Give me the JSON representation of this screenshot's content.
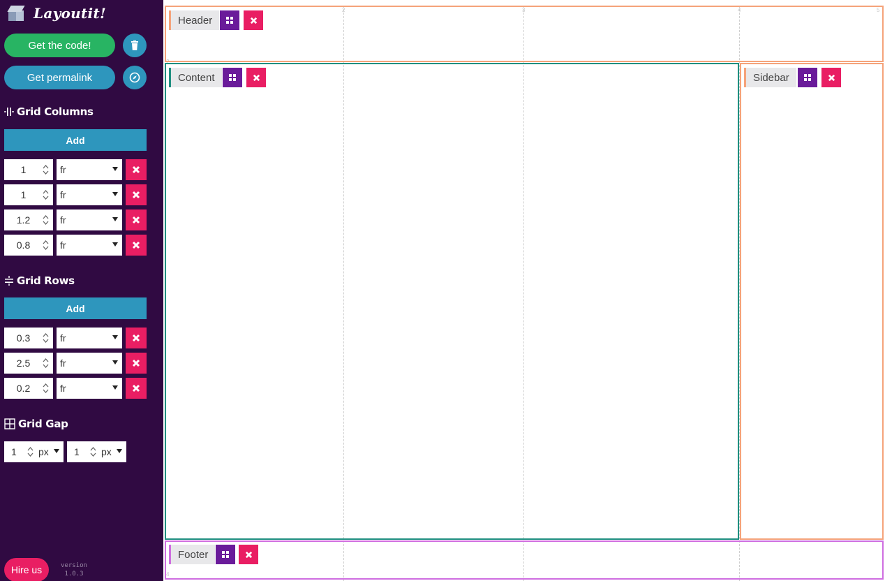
{
  "app": {
    "title": "Layoutit!"
  },
  "actions": {
    "get_code": "Get the code!",
    "get_permalink": "Get permalink"
  },
  "columns": {
    "title": "Grid Columns",
    "add_label": "Add",
    "items": [
      {
        "value": "1",
        "unit": "fr"
      },
      {
        "value": "1",
        "unit": "fr"
      },
      {
        "value": "1.2",
        "unit": "fr"
      },
      {
        "value": "0.8",
        "unit": "fr"
      }
    ]
  },
  "rows": {
    "title": "Grid Rows",
    "add_label": "Add",
    "items": [
      {
        "value": "0.3",
        "unit": "fr"
      },
      {
        "value": "2.5",
        "unit": "fr"
      },
      {
        "value": "0.2",
        "unit": "fr"
      }
    ]
  },
  "gap": {
    "title": "Grid Gap",
    "column": {
      "value": "1",
      "unit": "px"
    },
    "row": {
      "value": "1",
      "unit": "px"
    }
  },
  "footer": {
    "hire_label": "Hire us",
    "version_label": "version",
    "version_number": "1.0.3"
  },
  "grid": {
    "column_line_numbers": [
      "2",
      "3",
      "4",
      "5"
    ],
    "row_line_numbers": [
      "2",
      "4"
    ],
    "areas": {
      "header": {
        "label": "Header",
        "color": "#f5a37a"
      },
      "content": {
        "label": "Content",
        "color": "#1f8f80"
      },
      "sidebar": {
        "label": "Sidebar",
        "color": "#f5a37a"
      },
      "footer": {
        "label": "Footer",
        "color": "#cf6ee0"
      }
    }
  },
  "colors": {
    "sidebar_bg": "#300a42",
    "green": "#28b463",
    "blue": "#2e96bd",
    "pink": "#e91e63",
    "purple": "#6a1b9a"
  },
  "icons": {
    "logo": "cube-icon",
    "trash": "trash-icon",
    "permalink": "compass-icon",
    "columns": "columns-icon",
    "rows": "rows-icon",
    "gap": "grid-gap-icon",
    "edit_area": "grid-four-icon",
    "delete": "close-icon"
  }
}
